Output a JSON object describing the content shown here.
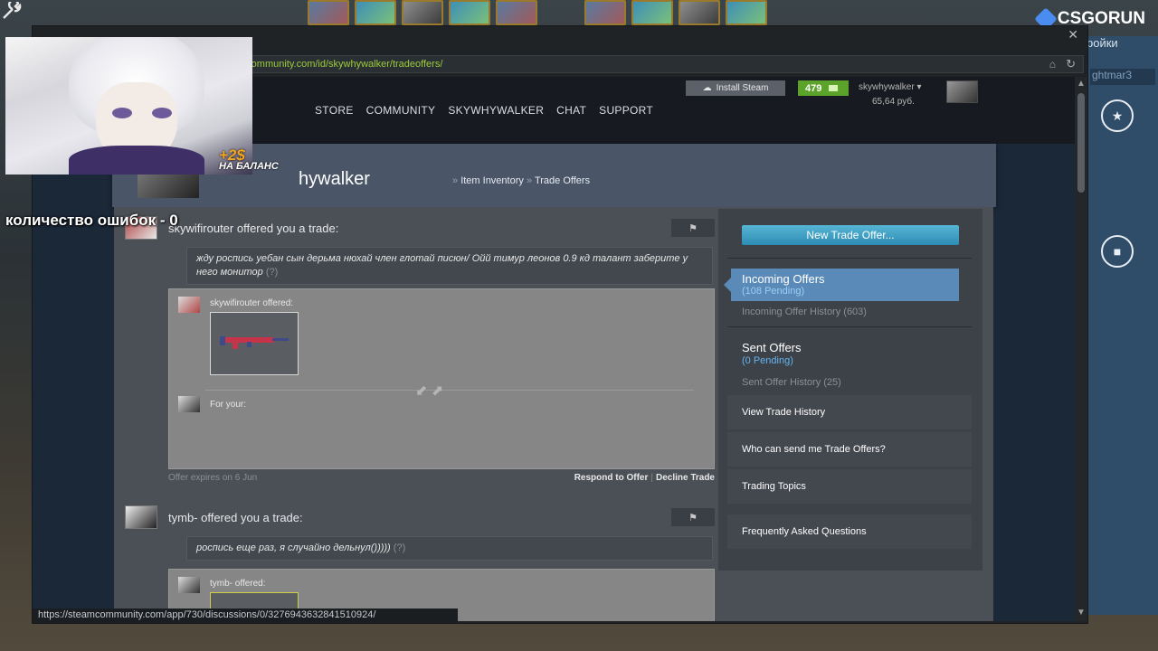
{
  "overlay": {
    "brand": "CSGORUN",
    "errors_text": "количество ошибок - 0",
    "bonus_amount": "+2$",
    "bonus_label": "НА БАЛАНС",
    "right_panel_label1": "ройки",
    "right_panel_label2": "ghtmar3"
  },
  "browser": {
    "url": "mcommunity.com/id/skywhywalker/tradeoffers/",
    "status_url": "https://steamcommunity.com/app/730/discussions/0/3276943632841510924/"
  },
  "steam": {
    "nav": [
      "STORE",
      "COMMUNITY",
      "SKYWHYWALKER",
      "CHAT",
      "SUPPORT"
    ],
    "install_label": "Install Steam",
    "wallet_count": "479",
    "account_name": "skywhywalker",
    "balance": "65,64 руб."
  },
  "profile": {
    "name": "hywalker",
    "crumb_sep": "»",
    "crumbs": [
      "Item Inventory",
      "Trade Offers"
    ]
  },
  "offers": [
    {
      "title": "skywifirouter offered you a trade:",
      "message": "жду роспись уебан сын дерьма нюхай член глотай писюн/ Ойй тимур леонов 0.9 кд талант заберите у него монитор",
      "message_q": "(?)",
      "offered_label": "skywifirouter offered:",
      "for_your_label": "For your:",
      "expires": "Offer expires on 6 Jun",
      "respond": "Respond to Offer",
      "decline": "Decline Trade"
    },
    {
      "title": "tymb- offered you a trade:",
      "message": "роспись еще раз, я случайно дельнул()))))",
      "message_q": "(?)",
      "offered_label": "tymb- offered:"
    }
  ],
  "sidebar": {
    "new_trade": "New Trade Offer...",
    "incoming_title": "Incoming Offers",
    "incoming_pending": "(108 Pending)",
    "incoming_history": "Incoming Offer History (603)",
    "sent_title": "Sent Offers",
    "sent_pending": "(0 Pending)",
    "sent_history": "Sent Offer History (25)",
    "view_history": "View Trade History",
    "who_can": "Who can send me Trade Offers?",
    "topics": "Trading Topics",
    "faq": "Frequently Asked Questions"
  },
  "icons": {
    "flag": "flag-icon",
    "wrench": "wrench-icon",
    "home": "home-icon",
    "refresh": "refresh-icon",
    "close": "close-icon"
  },
  "colors": {
    "wallet_green": "#5ba32b",
    "accent_blue": "#5a8ab8",
    "new_trade_blue": "#2d8cb4"
  }
}
